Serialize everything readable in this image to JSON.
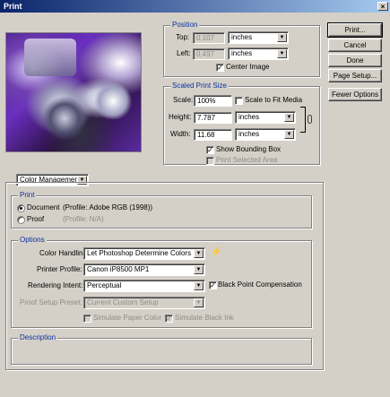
{
  "window": {
    "title": "Print",
    "close_glyph": "×"
  },
  "position": {
    "title": "Position",
    "top_label": "Top:",
    "top_value": "0.107",
    "top_unit": "inches",
    "left_label": "Left:",
    "left_value": "0.497",
    "left_unit": "inches",
    "center_image_label": "Center Image",
    "center_image_checked": true
  },
  "scaled": {
    "title": "Scaled Print Size",
    "scale_label": "Scale:",
    "scale_value": "100%",
    "scale_to_fit_label": "Scale to Fit Media",
    "scale_to_fit_checked": false,
    "height_label": "Height:",
    "height_value": "7.787",
    "height_unit": "inches",
    "width_label": "Width:",
    "width_value": "11.68",
    "width_unit": "inches",
    "show_bbox_label": "Show Bounding Box",
    "show_bbox_checked": true,
    "print_selected_label": "Print Selected Area",
    "print_selected_checked": false
  },
  "buttons": {
    "print": "Print...",
    "cancel": "Cancel",
    "done": "Done",
    "page_setup": "Page Setup...",
    "fewer_options": "Fewer Options"
  },
  "mode_select": {
    "value": "Color Management"
  },
  "print_group": {
    "title": "Print",
    "document_label": "Document",
    "document_profile": "(Profile: Adobe RGB (1998))",
    "document_selected": true,
    "proof_label": "Proof",
    "proof_profile": "(Profile: N/A)",
    "proof_selected": false
  },
  "options": {
    "title": "Options",
    "color_handling_label": "Color Handling:",
    "color_handling_value": "Let Photoshop Determine Colors",
    "printer_profile_label": "Printer Profile:",
    "printer_profile_value": "Canon iP8500 MP1",
    "rendering_intent_label": "Rendering Intent:",
    "rendering_intent_value": "Perceptual",
    "black_point_label": "Black Point Compensation",
    "black_point_checked": true,
    "proof_setup_label": "Proof Setup Preset:",
    "proof_setup_value": "Current Custom Setup",
    "simulate_paper_label": "Simulate Paper Color",
    "simulate_paper_checked": false,
    "simulate_ink_label": "Simulate Black Ink",
    "simulate_ink_checked": true
  },
  "description": {
    "title": "Description"
  },
  "icons": {
    "info": "info-icon",
    "link": "chain-link-icon",
    "dropdown": "chevron-down-icon"
  }
}
